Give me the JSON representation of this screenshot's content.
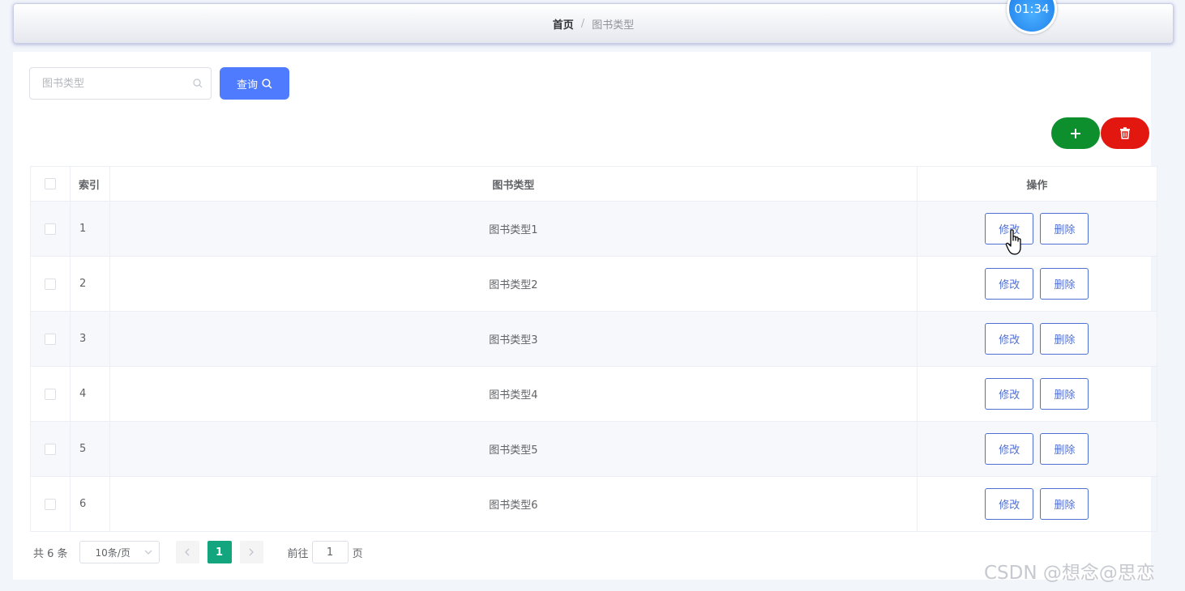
{
  "breadcrumb": {
    "home": "首页",
    "separator": "/",
    "current": "图书类型"
  },
  "timer": "01:34",
  "search": {
    "placeholder": "图书类型",
    "value": "",
    "query_label": "查询"
  },
  "toolbar": {
    "add_icon": "plus-icon",
    "delete_icon": "trash-icon"
  },
  "colors": {
    "primary": "#4f7cfe",
    "add": "#0c8f2c",
    "danger": "#e2170f",
    "page_active": "#13a57e",
    "op_border": "#4f6fd3"
  },
  "table": {
    "headers": {
      "index": "索引",
      "name": "图书类型",
      "ops": "操作"
    },
    "rows": [
      {
        "index": "1",
        "name": "图书类型1",
        "edit": "修改",
        "delete": "删除"
      },
      {
        "index": "2",
        "name": "图书类型2",
        "edit": "修改",
        "delete": "删除"
      },
      {
        "index": "3",
        "name": "图书类型3",
        "edit": "修改",
        "delete": "删除"
      },
      {
        "index": "4",
        "name": "图书类型4",
        "edit": "修改",
        "delete": "删除"
      },
      {
        "index": "5",
        "name": "图书类型5",
        "edit": "修改",
        "delete": "删除"
      },
      {
        "index": "6",
        "name": "图书类型6",
        "edit": "修改",
        "delete": "删除"
      }
    ]
  },
  "pagination": {
    "total": "共 6 条",
    "page_size": "10条/页",
    "current_page": "1",
    "goto_label": "前往",
    "goto_value": "1",
    "goto_unit": "页"
  },
  "watermark": "CSDN @想念@思恋"
}
